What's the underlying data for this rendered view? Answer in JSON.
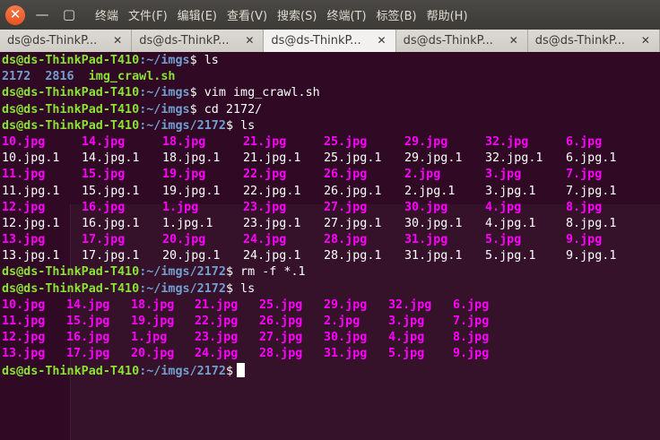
{
  "window": {
    "close_glyph": "✕",
    "minimize_glyph": "—",
    "maximize_glyph": "▢"
  },
  "menu": [
    "终端",
    "文件(F)",
    "编辑(E)",
    "查看(V)",
    "搜索(S)",
    "终端(T)",
    "标签(B)",
    "帮助(H)"
  ],
  "tabs": [
    {
      "label": "ds@ds-ThinkP...",
      "active": false
    },
    {
      "label": "ds@ds-ThinkP...",
      "active": false
    },
    {
      "label": "ds@ds-ThinkP...",
      "active": true
    },
    {
      "label": "ds@ds-ThinkP...",
      "active": false
    },
    {
      "label": "ds@ds-ThinkP...",
      "active": false
    }
  ],
  "tab_close_glyph": "✕",
  "prompt": {
    "user": "ds@ds-ThinkPad-T410",
    "path_imgs": ":~/imgs",
    "path_2172": ":~/imgs/2172",
    "dollar": "$"
  },
  "commands": {
    "c1": " ls",
    "c2": " vim img_crawl.sh",
    "c3": " cd 2172/",
    "c4": " ls",
    "c5": " rm -f *.1",
    "c6": " ls"
  },
  "ls_imgs": {
    "dir1": "2172",
    "dir2": "2816",
    "exec": "img_crawl.sh"
  },
  "listing1": [
    [
      "10.jpg",
      "14.jpg",
      "18.jpg",
      "21.jpg",
      "25.jpg",
      "29.jpg",
      "32.jpg",
      "6.jpg"
    ],
    [
      "10.jpg.1",
      "14.jpg.1",
      "18.jpg.1",
      "21.jpg.1",
      "25.jpg.1",
      "29.jpg.1",
      "32.jpg.1",
      "6.jpg.1"
    ],
    [
      "11.jpg",
      "15.jpg",
      "19.jpg",
      "22.jpg",
      "26.jpg",
      "2.jpg",
      "3.jpg",
      "7.jpg"
    ],
    [
      "11.jpg.1",
      "15.jpg.1",
      "19.jpg.1",
      "22.jpg.1",
      "26.jpg.1",
      "2.jpg.1",
      "3.jpg.1",
      "7.jpg.1"
    ],
    [
      "12.jpg",
      "16.jpg",
      "1.jpg",
      "23.jpg",
      "27.jpg",
      "30.jpg",
      "4.jpg",
      "8.jpg"
    ],
    [
      "12.jpg.1",
      "16.jpg.1",
      "1.jpg.1",
      "23.jpg.1",
      "27.jpg.1",
      "30.jpg.1",
      "4.jpg.1",
      "8.jpg.1"
    ],
    [
      "13.jpg",
      "17.jpg",
      "20.jpg",
      "24.jpg",
      "28.jpg",
      "31.jpg",
      "5.jpg",
      "9.jpg"
    ],
    [
      "13.jpg.1",
      "17.jpg.1",
      "20.jpg.1",
      "24.jpg.1",
      "28.jpg.1",
      "31.jpg.1",
      "5.jpg.1",
      "9.jpg.1"
    ]
  ],
  "listing2": [
    [
      "10.jpg",
      "14.jpg",
      "18.jpg",
      "21.jpg",
      "25.jpg",
      "29.jpg",
      "32.jpg",
      "6.jpg"
    ],
    [
      "11.jpg",
      "15.jpg",
      "19.jpg",
      "22.jpg",
      "26.jpg",
      "2.jpg",
      "3.jpg",
      "7.jpg"
    ],
    [
      "12.jpg",
      "16.jpg",
      "1.jpg",
      "23.jpg",
      "27.jpg",
      "30.jpg",
      "4.jpg",
      "8.jpg"
    ],
    [
      "13.jpg",
      "17.jpg",
      "20.jpg",
      "24.jpg",
      "28.jpg",
      "31.jpg",
      "5.jpg",
      "9.jpg"
    ]
  ],
  "colors": {
    "background": "#300a24",
    "prompt_user": "#8ae234",
    "prompt_path": "#729fcf",
    "jpg_file": "#ff00ff",
    "plain_file": "#ffffff",
    "accent_close": "#e95420"
  }
}
